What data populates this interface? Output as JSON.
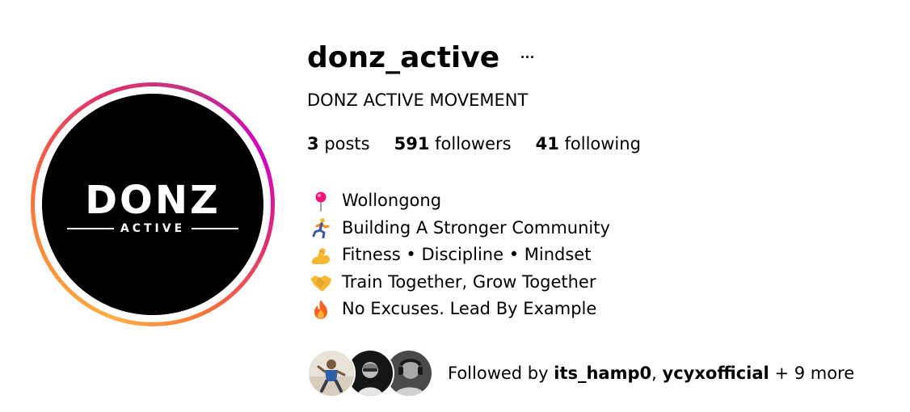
{
  "profile": {
    "username": "donz_active",
    "display_name": "DONZ ACTIVE MOVEMENT",
    "avatar": {
      "logo_main": "DONZ",
      "logo_sub": "ACTIVE"
    },
    "more_icon": "more-horizontal-icon"
  },
  "stats": {
    "posts_count": "3",
    "posts_label": "posts",
    "followers_count": "591",
    "followers_label": "followers",
    "following_count": "41",
    "following_label": "following"
  },
  "bio": {
    "lines": [
      {
        "icon": "pin-icon",
        "text": "Wollongong"
      },
      {
        "icon": "runner-icon",
        "text": "Building A Stronger Community"
      },
      {
        "icon": "flexed-biceps-icon",
        "text": "Fitness • Discipline • Mindset"
      },
      {
        "icon": "handshake-icon",
        "text": "Train Together, Grow Together"
      },
      {
        "icon": "fire-icon",
        "text": "No Excuses. Lead By Example"
      }
    ]
  },
  "followed_by": {
    "prefix": "Followed by",
    "user1": "its_hamp0",
    "separator": ",",
    "user2": "ycyxofficial",
    "suffix": "+ 9 more"
  },
  "colors": {
    "ring_gradient": [
      "#fcaf45",
      "#f56040",
      "#e1306c",
      "#c13584",
      "#d300c5"
    ],
    "text": "#000000",
    "background": "#ffffff"
  }
}
